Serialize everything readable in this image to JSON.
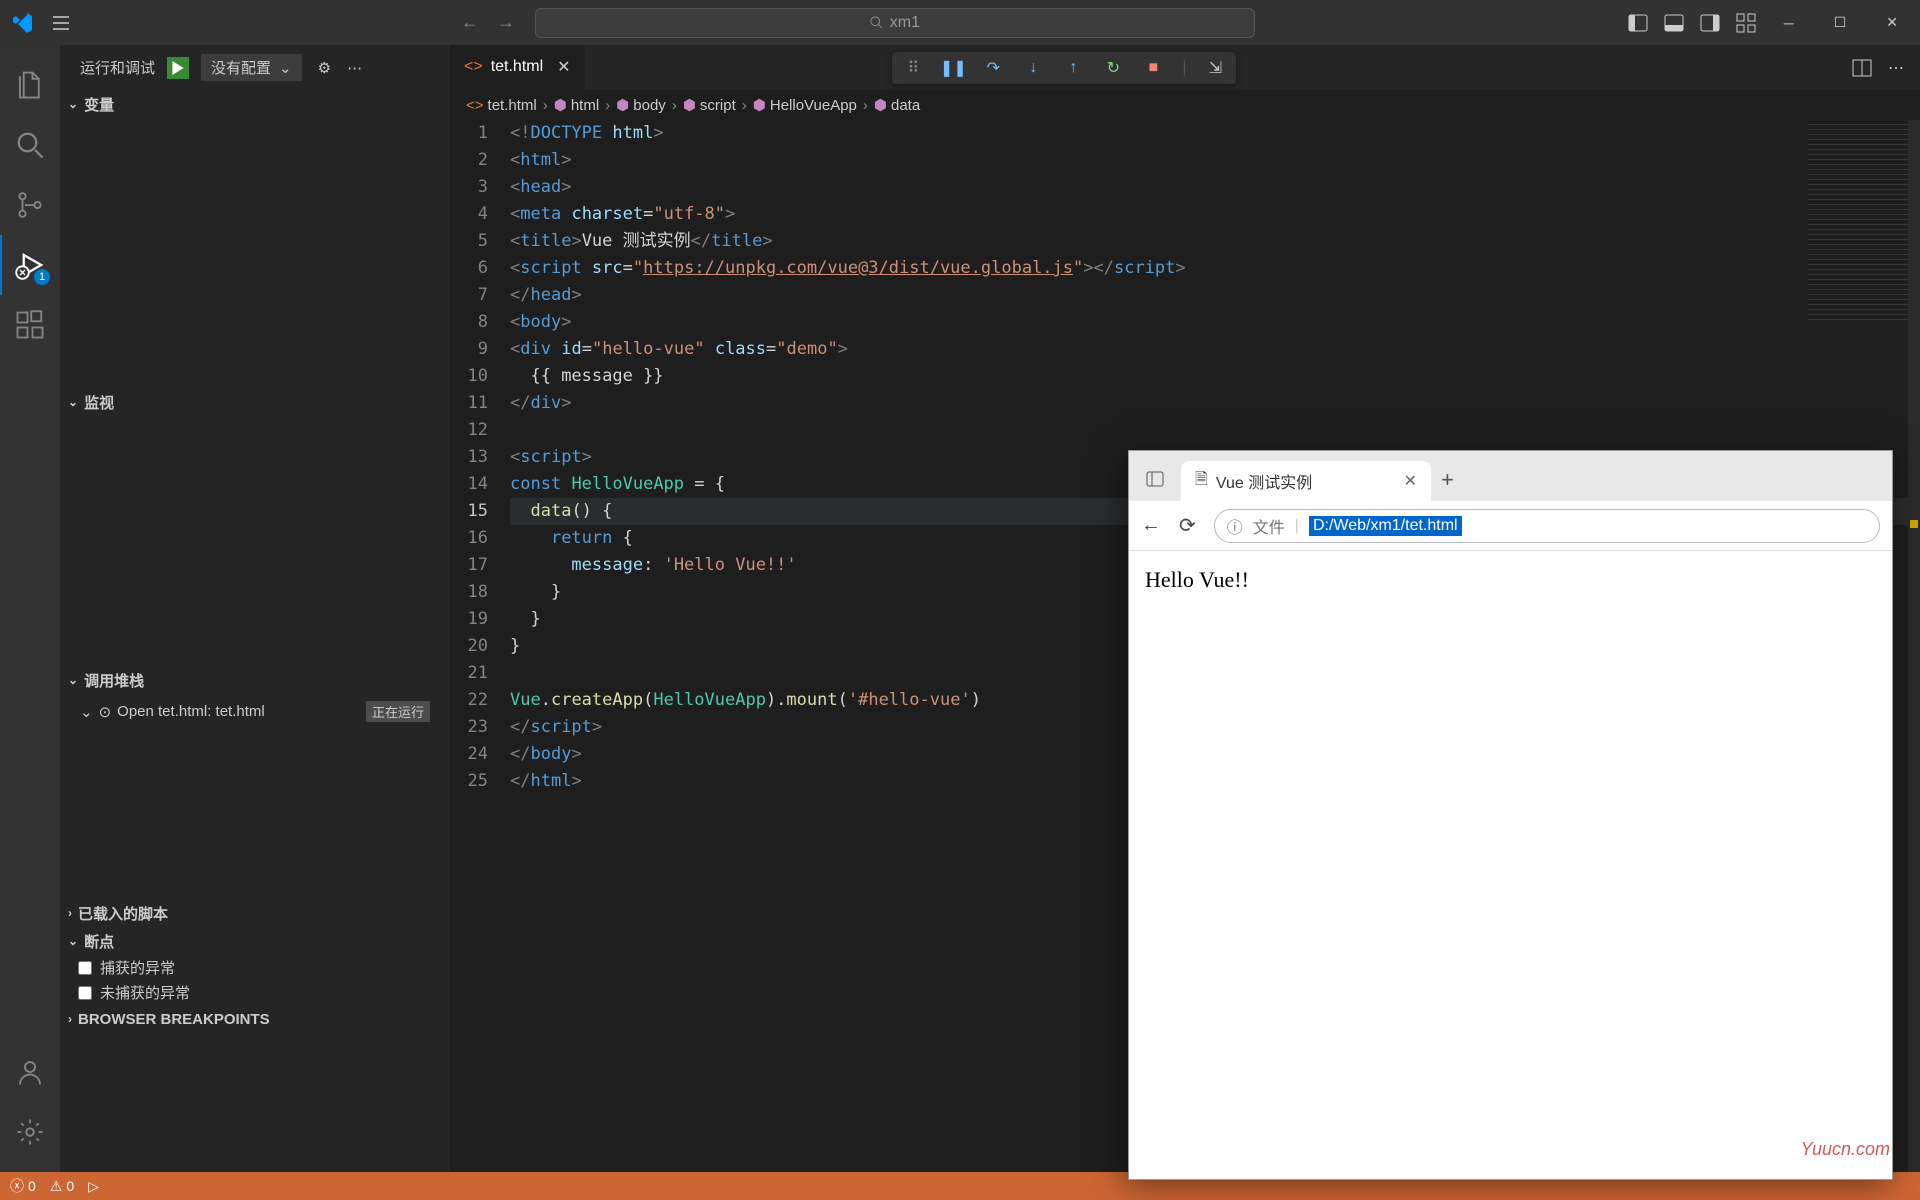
{
  "titlebar": {
    "search_text": "xm1"
  },
  "sidebar": {
    "run_label": "运行和调试",
    "config_label": "没有配置",
    "variables_label": "变量",
    "watch_label": "监视",
    "callstack_label": "调用堆栈",
    "callstack_item": "Open tet.html: tet.html",
    "callstack_status": "正在运行",
    "loaded_scripts_label": "已载入的脚本",
    "breakpoints_label": "断点",
    "bp_caught": "捕获的异常",
    "bp_uncaught": "未捕获的异常",
    "browser_bp_label": "BROWSER BREAKPOINTS"
  },
  "tabs": {
    "file": "tet.html"
  },
  "breadcrumbs": {
    "file": "tet.html",
    "p1": "html",
    "p2": "body",
    "p3": "script",
    "p4": "HelloVueApp",
    "p5": "data"
  },
  "code": {
    "lines": [
      1,
      2,
      3,
      4,
      5,
      6,
      7,
      8,
      9,
      10,
      11,
      12,
      13,
      14,
      15,
      16,
      17,
      18,
      19,
      20,
      21,
      22,
      23,
      24,
      25
    ],
    "current_line": 15,
    "l1_doctype": "DOCTYPE",
    "l1_html": "html",
    "l5_title_text": "Vue 测试实例",
    "l6_src": "https://unpkg.com/vue@3/dist/vue.global.js",
    "l9_id": "hello-vue",
    "l9_class": "demo",
    "l10_mustache": "{{ message }}",
    "l14_const": "const",
    "l14_name": "HelloVueApp",
    "l15_data": "data",
    "l16_return": "return",
    "l17_key": "message",
    "l17_val": "'Hello Vue!!'",
    "l22_vue": "Vue",
    "l22_create": "createApp",
    "l22_arg": "HelloVueApp",
    "l22_mount": "mount",
    "l22_sel": "'#hello-vue'"
  },
  "statusbar": {
    "errors": "0",
    "warnings": "0"
  },
  "browser": {
    "tab_title": "Vue 测试实例",
    "addr_label": "文件",
    "addr_url": "D:/Web/xm1/tet.html",
    "page_text": "Hello Vue!!"
  },
  "watermark": "Yuucn.com",
  "debug_badge": "1"
}
